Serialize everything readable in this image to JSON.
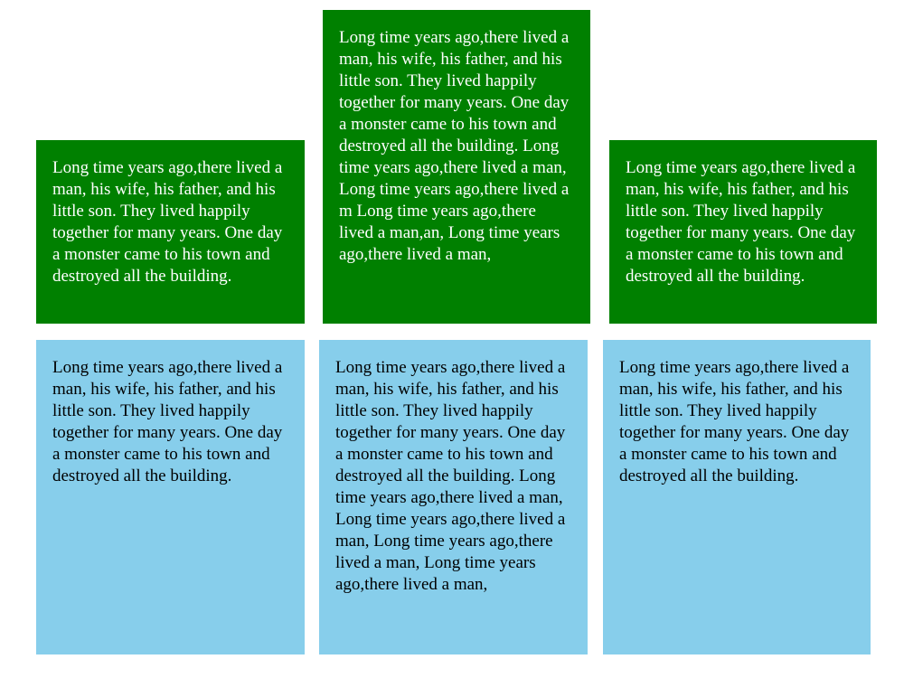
{
  "colors": {
    "green_box": "#008000",
    "blue_box": "#87ceeb",
    "green_text": "#ffffff",
    "blue_text": "#000000"
  },
  "green_row": [
    {
      "text": "Long time years ago,there lived a man, his wife, his father, and his little son. They lived happily together for many years. One day a monster came to his town and destroyed all the building."
    },
    {
      "text": "Long time years ago,there lived a man, his wife, his father, and his little son. They lived happily together for many years. One day a monster came to his town and destroyed all the building. Long time years ago,there lived a man, Long time years ago,there lived a m Long time years ago,there lived a man,an, Long time years ago,there lived a man,"
    },
    {
      "text": "Long time years ago,there lived a man, his wife, his father, and his little son. They lived happily together for many years. One day a monster came to his town and destroyed all the building."
    }
  ],
  "blue_row": [
    {
      "text": "Long time years ago,there lived a man, his wife, his father, and his little son. They lived happily together for many years. One day a monster came to his town and destroyed all the building."
    },
    {
      "text": "Long time years ago,there lived a man, his wife, his father, and his little son. They lived happily together for many years. One day a monster came to his town and destroyed all the building. Long time years ago,there lived a man, Long time years ago,there lived a man, Long time years ago,there lived a man, Long time years ago,there lived a man,"
    },
    {
      "text": "Long time years ago,there lived a man, his wife, his father, and his little son. They lived happily together for many years. One day a monster came to his town and destroyed all the building."
    }
  ]
}
